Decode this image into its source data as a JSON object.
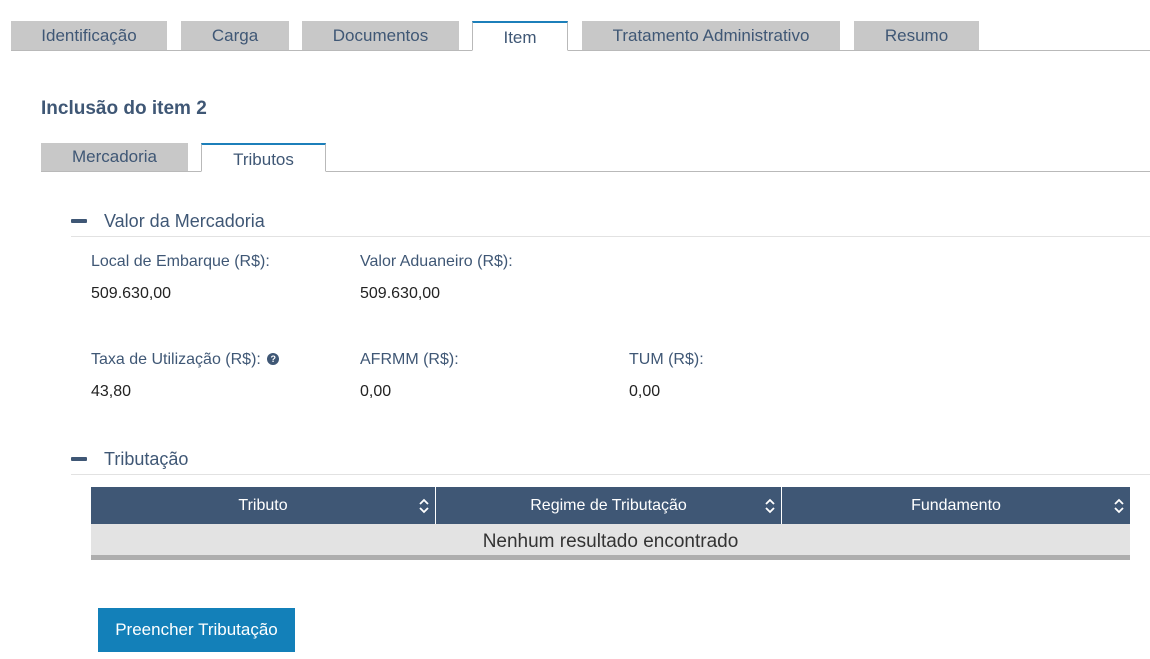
{
  "top_tabs": [
    "Identificação",
    "Carga",
    "Documentos",
    "Item",
    "Tratamento Administrativo",
    "Resumo"
  ],
  "page_title": "Inclusão do item 2",
  "sub_tabs": [
    "Mercadoria",
    "Tributos"
  ],
  "valor_mercadoria": {
    "title": "Valor da Mercadoria",
    "local_embarque_label": "Local de Embarque (R$):",
    "local_embarque_value": "509.630,00",
    "valor_aduaneiro_label": "Valor Aduaneiro (R$):",
    "valor_aduaneiro_value": "509.630,00",
    "taxa_utilizacao_label": "Taxa de Utilização (R$):",
    "taxa_utilizacao_value": "43,80",
    "afrmm_label": "AFRMM (R$):",
    "afrmm_value": "0,00",
    "tum_label": "TUM (R$):",
    "tum_value": "0,00"
  },
  "tributacao": {
    "title": "Tributação",
    "columns": [
      "Tributo",
      "Regime de Tributação",
      "Fundamento"
    ],
    "empty_message": "Nenhum resultado encontrado"
  },
  "fill_button_label": "Preencher Tributação",
  "colors": {
    "primary": "#1380b9",
    "header": "#3f5775",
    "tab_inactive": "#c8c8c8"
  },
  "icons": {
    "help": "question-circle-icon",
    "sort": "sort-up-down-icon",
    "collapse": "minus-icon"
  }
}
